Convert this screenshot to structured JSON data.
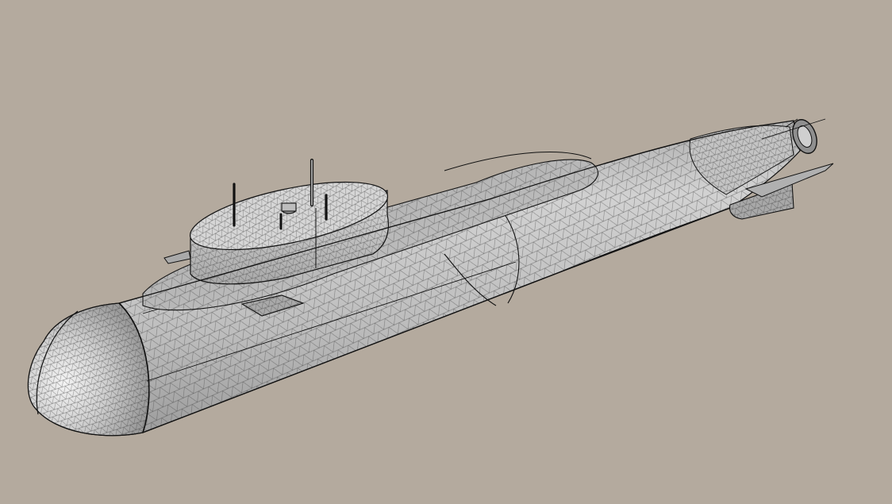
{
  "scene": {
    "background_color": "#b4aa9e",
    "model": "submarine-mesh",
    "render_mode": "wireframe-mesh",
    "surface_color": "#c9c9c9",
    "highlight_color": "#f4f4f4",
    "shadow_color": "#8e8e8e",
    "mesh_line_color": "#3a3a3a",
    "edge_color": "#111111"
  }
}
